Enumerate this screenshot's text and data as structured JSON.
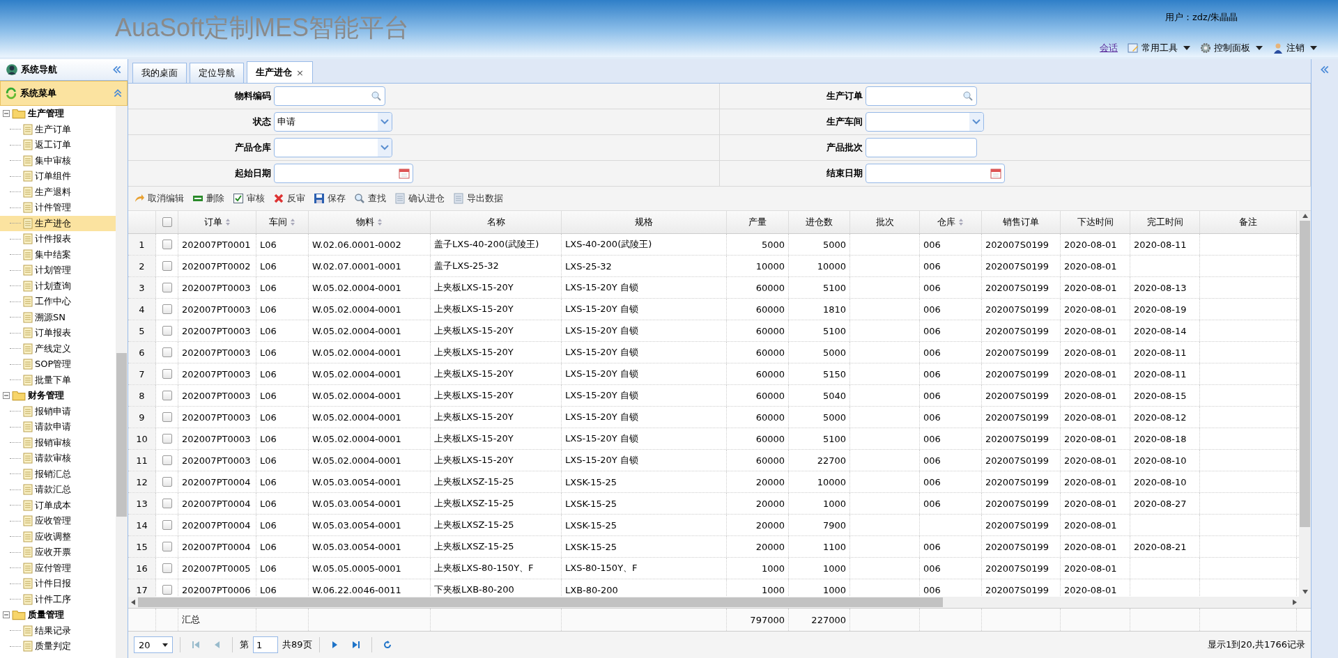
{
  "header": {
    "title": "AuaSoft定制MES智能平台",
    "user": "用户：zdz/朱晶晶",
    "links": [
      {
        "label": "会话",
        "kind": "link"
      },
      {
        "label": "常用工具",
        "kind": "menu"
      },
      {
        "label": "控制面板",
        "kind": "menu"
      },
      {
        "label": "注销",
        "kind": "menu"
      }
    ]
  },
  "sidebar": {
    "title": "系统导航",
    "menu_title": "系统菜单",
    "tree": [
      {
        "label": "生产管理",
        "expanded": true,
        "children": [
          {
            "label": "生产订单",
            "selected": false
          },
          {
            "label": "返工订单",
            "selected": false
          },
          {
            "label": "集中审核",
            "selected": false
          },
          {
            "label": "订单组件",
            "selected": false
          },
          {
            "label": "生产退料",
            "selected": false
          },
          {
            "label": "计件管理",
            "selected": false
          },
          {
            "label": "生产进仓",
            "selected": true
          },
          {
            "label": "计件报表",
            "selected": false
          },
          {
            "label": "集中结案",
            "selected": false
          },
          {
            "label": "计划管理",
            "selected": false
          },
          {
            "label": "计划查询",
            "selected": false
          },
          {
            "label": "工作中心",
            "selected": false
          },
          {
            "label": "溯源SN",
            "selected": false
          },
          {
            "label": "订单报表",
            "selected": false
          },
          {
            "label": "产线定义",
            "selected": false
          },
          {
            "label": "SOP管理",
            "selected": false
          },
          {
            "label": "批量下单",
            "selected": false
          }
        ]
      },
      {
        "label": "财务管理",
        "expanded": true,
        "children": [
          {
            "label": "报销申请",
            "selected": false
          },
          {
            "label": "请款申请",
            "selected": false
          },
          {
            "label": "报销审核",
            "selected": false
          },
          {
            "label": "请款审核",
            "selected": false
          },
          {
            "label": "报销汇总",
            "selected": false
          },
          {
            "label": "请款汇总",
            "selected": false
          },
          {
            "label": "订单成本",
            "selected": false
          },
          {
            "label": "应收管理",
            "selected": false
          },
          {
            "label": "应收调整",
            "selected": false
          },
          {
            "label": "应收开票",
            "selected": false
          },
          {
            "label": "应付管理",
            "selected": false
          },
          {
            "label": "计件日报",
            "selected": false
          },
          {
            "label": "计件工序",
            "selected": false
          }
        ]
      },
      {
        "label": "质量管理",
        "expanded": true,
        "children": [
          {
            "label": "结果记录",
            "selected": false
          },
          {
            "label": "质量判定",
            "selected": false
          }
        ]
      }
    ]
  },
  "tabs": [
    {
      "label": "我的桌面",
      "selected": false
    },
    {
      "label": "定位导航",
      "selected": false
    },
    {
      "label": "生产进仓",
      "selected": true,
      "close": "×"
    }
  ],
  "form": [
    [
      {
        "label": "物料编码",
        "kind": "search"
      },
      {
        "label": "生产订单",
        "kind": "search"
      }
    ],
    [
      {
        "label": "状态",
        "kind": "select",
        "value": "申请"
      },
      {
        "label": "生产车间",
        "kind": "select"
      }
    ],
    [
      {
        "label": "产品仓库",
        "kind": "select"
      },
      {
        "label": "产品批次",
        "kind": "text"
      }
    ],
    [
      {
        "label": "起始日期",
        "kind": "date"
      },
      {
        "label": "结束日期",
        "kind": "date"
      }
    ]
  ],
  "toolbar": [
    {
      "label": "取消编辑"
    },
    {
      "label": "删除"
    },
    {
      "label": "审核"
    },
    {
      "label": "反审"
    },
    {
      "label": "保存"
    },
    {
      "label": "查找"
    },
    {
      "label": "确认进仓"
    },
    {
      "label": "导出数据"
    }
  ],
  "table": {
    "all_checked": false,
    "columns": [
      {
        "label": "订单",
        "sortable": true
      },
      {
        "label": "车间",
        "sortable": true
      },
      {
        "label": "物料",
        "sortable": true
      },
      {
        "label": "名称",
        "sortable": false
      },
      {
        "label": "规格",
        "sortable": false
      },
      {
        "label": "产量",
        "sortable": false
      },
      {
        "label": "进仓数",
        "sortable": false
      },
      {
        "label": "批次",
        "sortable": false
      },
      {
        "label": "仓库",
        "sortable": true
      },
      {
        "label": "销售订单",
        "sortable": false
      },
      {
        "label": "下达时间",
        "sortable": false
      },
      {
        "label": "完工时间",
        "sortable": false
      },
      {
        "label": "备注",
        "sortable": false
      }
    ],
    "rows": [
      {
        "no": "1",
        "checked": false,
        "cells": [
          "202007PT0001",
          "L06",
          "W.02.06.0001-0002",
          "盖子LXS-40-200(武陵王)",
          "LXS-40-200(武陵王)",
          "5000",
          "5000",
          null,
          "006",
          "202007S0199",
          "2020-08-01",
          "2020-08-11",
          null
        ]
      },
      {
        "no": "2",
        "checked": false,
        "cells": [
          "202007PT0002",
          "L06",
          "W.02.07.0001-0001",
          "盖子LXS-25-32",
          "LXS-25-32",
          "10000",
          "10000",
          null,
          "006",
          "202007S0199",
          "2020-08-01",
          null,
          null
        ]
      },
      {
        "no": "3",
        "checked": false,
        "cells": [
          "202007PT0003",
          "L06",
          "W.05.02.0004-0001",
          "上夹板LXS-15-20Y",
          "LXS-15-20Y 自锁",
          "60000",
          "5100",
          null,
          "006",
          "202007S0199",
          "2020-08-01",
          "2020-08-13",
          null
        ]
      },
      {
        "no": "4",
        "checked": false,
        "cells": [
          "202007PT0003",
          "L06",
          "W.05.02.0004-0001",
          "上夹板LXS-15-20Y",
          "LXS-15-20Y 自锁",
          "60000",
          "1810",
          null,
          "006",
          "202007S0199",
          "2020-08-01",
          "2020-08-19",
          null
        ]
      },
      {
        "no": "5",
        "checked": false,
        "cells": [
          "202007PT0003",
          "L06",
          "W.05.02.0004-0001",
          "上夹板LXS-15-20Y",
          "LXS-15-20Y 自锁",
          "60000",
          "5100",
          null,
          "006",
          "202007S0199",
          "2020-08-01",
          "2020-08-14",
          null
        ]
      },
      {
        "no": "6",
        "checked": false,
        "cells": [
          "202007PT0003",
          "L06",
          "W.05.02.0004-0001",
          "上夹板LXS-15-20Y",
          "LXS-15-20Y 自锁",
          "60000",
          "5000",
          null,
          "006",
          "202007S0199",
          "2020-08-01",
          "2020-08-11",
          null
        ]
      },
      {
        "no": "7",
        "checked": false,
        "cells": [
          "202007PT0003",
          "L06",
          "W.05.02.0004-0001",
          "上夹板LXS-15-20Y",
          "LXS-15-20Y 自锁",
          "60000",
          "5150",
          null,
          "006",
          "202007S0199",
          "2020-08-01",
          "2020-08-11",
          null
        ]
      },
      {
        "no": "8",
        "checked": false,
        "cells": [
          "202007PT0003",
          "L06",
          "W.05.02.0004-0001",
          "上夹板LXS-15-20Y",
          "LXS-15-20Y 自锁",
          "60000",
          "5040",
          null,
          "006",
          "202007S0199",
          "2020-08-01",
          "2020-08-15",
          null
        ]
      },
      {
        "no": "9",
        "checked": false,
        "cells": [
          "202007PT0003",
          "L06",
          "W.05.02.0004-0001",
          "上夹板LXS-15-20Y",
          "LXS-15-20Y 自锁",
          "60000",
          "5000",
          null,
          "006",
          "202007S0199",
          "2020-08-01",
          "2020-08-12",
          null
        ]
      },
      {
        "no": "10",
        "checked": false,
        "cells": [
          "202007PT0003",
          "L06",
          "W.05.02.0004-0001",
          "上夹板LXS-15-20Y",
          "LXS-15-20Y 自锁",
          "60000",
          "5100",
          null,
          "006",
          "202007S0199",
          "2020-08-01",
          "2020-08-18",
          null
        ]
      },
      {
        "no": "11",
        "checked": false,
        "cells": [
          "202007PT0003",
          "L06",
          "W.05.02.0004-0001",
          "上夹板LXS-15-20Y",
          "LXS-15-20Y 自锁",
          "60000",
          "22700",
          null,
          "006",
          "202007S0199",
          "2020-08-01",
          "2020-08-10",
          null
        ]
      },
      {
        "no": "12",
        "checked": false,
        "cells": [
          "202007PT0004",
          "L06",
          "W.05.03.0054-0001",
          "上夹板LXSZ-15-25",
          "LXSK-15-25",
          "20000",
          "10000",
          null,
          "006",
          "202007S0199",
          "2020-08-01",
          "2020-08-10",
          null
        ]
      },
      {
        "no": "13",
        "checked": false,
        "cells": [
          "202007PT0004",
          "L06",
          "W.05.03.0054-0001",
          "上夹板LXSZ-15-25",
          "LXSK-15-25",
          "20000",
          "1000",
          null,
          "006",
          "202007S0199",
          "2020-08-01",
          "2020-08-27",
          null
        ]
      },
      {
        "no": "14",
        "checked": false,
        "cells": [
          "202007PT0004",
          "L06",
          "W.05.03.0054-0001",
          "上夹板LXSZ-15-25",
          "LXSK-15-25",
          "20000",
          "7900",
          null,
          null,
          "202007S0199",
          "2020-08-01",
          null,
          null
        ]
      },
      {
        "no": "15",
        "checked": false,
        "cells": [
          "202007PT0004",
          "L06",
          "W.05.03.0054-0001",
          "上夹板LXSZ-15-25",
          "LXSK-15-25",
          "20000",
          "1100",
          null,
          "006",
          "202007S0199",
          "2020-08-01",
          "2020-08-21",
          null
        ]
      },
      {
        "no": "16",
        "checked": false,
        "cells": [
          "202007PT0005",
          "L06",
          "W.05.05.0005-0001",
          "上夹板LXS-80-150Y、F",
          "LXS-80-150Y、F",
          "1000",
          "1000",
          null,
          "006",
          "202007S0199",
          "2020-08-01",
          null,
          null
        ]
      },
      {
        "no": "17",
        "checked": false,
        "cells": [
          "202007PT0006",
          "L06",
          "W.06.22.0046-0011",
          "下夹板LXB-80-200",
          "LXB-80-200",
          "1000",
          "1000",
          null,
          "006",
          "202007S0199",
          "2020-08-01",
          null,
          null
        ]
      }
    ],
    "footer": {
      "label": "汇总",
      "output_total": "797000",
      "stock_in_total": "227000"
    }
  },
  "pager": {
    "page_size": "20",
    "page_prefix": "第",
    "page": "1",
    "page_total": "共89页",
    "summary": "显示1到20,共1766记录"
  }
}
